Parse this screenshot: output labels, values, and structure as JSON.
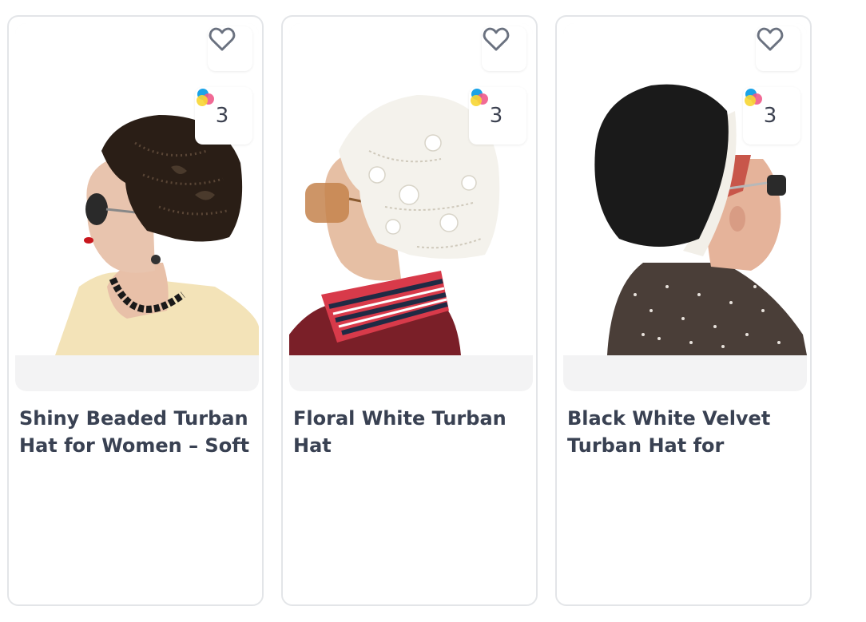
{
  "colors": {
    "card_border": "#e3e5e8",
    "title_text": "#394152",
    "media_bg": "#f3f3f4",
    "icon_stroke": "#6b7280"
  },
  "products": [
    {
      "title": "Shiny Beaded Turban Hat for Women – Soft",
      "variant_count": "3",
      "favorite_icon": "heart-outline-icon",
      "variant_icon": "color-swatch-icon",
      "image_alt": "Black beaded turban hat"
    },
    {
      "title": "Floral White Turban Hat",
      "variant_count": "3",
      "favorite_icon": "heart-outline-icon",
      "variant_icon": "color-swatch-icon",
      "image_alt": "White floral embroidered turban hat"
    },
    {
      "title": "Black White Velvet Turban Hat for Women",
      "variant_count": "3",
      "favorite_icon": "heart-outline-icon",
      "variant_icon": "color-swatch-icon",
      "image_alt": "Black velvet turban hat with white band"
    }
  ]
}
